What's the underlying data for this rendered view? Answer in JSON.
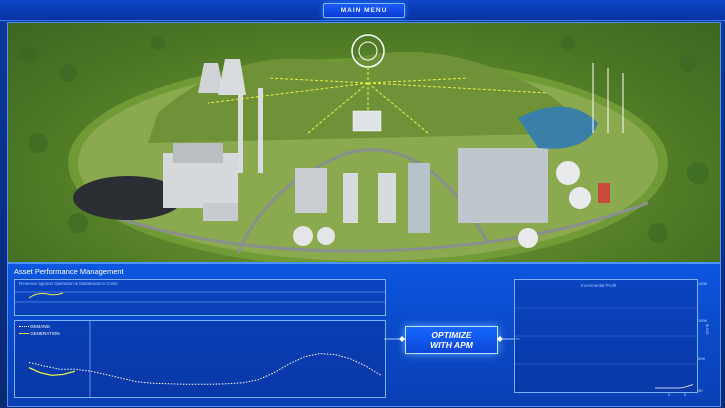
{
  "topbar": {
    "menu_label": "MAIN MENU"
  },
  "panel": {
    "title": "Asset Performance Management",
    "optimize_line1": "OPTIMIZE",
    "optimize_line2": "WITH APM",
    "top_chart_title": "Revenue against Operation & Maintenance Costs",
    "right_chart_title": "Incremental Profit",
    "legend": {
      "demand": "DEMAND",
      "generation": "GENERATION"
    },
    "right_axis_ticks": [
      "150K",
      "100K",
      "50K",
      "0K"
    ],
    "right_axis_label": "$USD",
    "right_x_ticks": [
      "0",
      "5"
    ]
  },
  "colors": {
    "accent": "#2e7bff",
    "panel_bg": "#0c56e0",
    "demand_line": "#ffffff",
    "generation_line": "#e6f04a",
    "scene_grass": "#5f8a2d"
  },
  "chart_data": [
    {
      "type": "line",
      "title": "",
      "series": [
        {
          "name": "DEMAND",
          "values": [
            0.55,
            0.48,
            0.42,
            0.42,
            0.38,
            0.32,
            0.25,
            0.18,
            0.15,
            0.14,
            0.13,
            0.13,
            0.13,
            0.14,
            0.16,
            0.22,
            0.35,
            0.52,
            0.66,
            0.72,
            0.7,
            0.62,
            0.48,
            0.3
          ]
        },
        {
          "name": "GENERATION",
          "values": [
            0.45,
            0.35,
            0.3,
            0.32,
            0.38
          ]
        }
      ],
      "x": [
        0,
        1,
        2,
        3,
        4,
        5,
        6,
        7,
        8,
        9,
        10,
        11,
        12,
        13,
        14,
        15,
        16,
        17,
        18,
        19,
        20,
        21,
        22,
        23
      ],
      "ylim": [
        0,
        1
      ]
    },
    {
      "type": "line",
      "title": "Incremental Profit",
      "series": [
        {
          "name": "",
          "values": [
            0,
            0,
            0,
            0,
            0,
            0.02,
            0.05
          ]
        }
      ],
      "ylim": [
        0,
        150
      ]
    }
  ]
}
